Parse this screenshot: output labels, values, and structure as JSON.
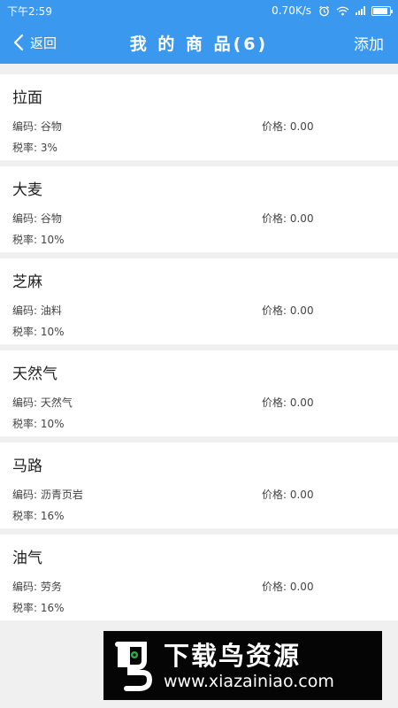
{
  "status_bar": {
    "time": "下午2:59",
    "network_speed": "0.70K/s",
    "icons": [
      "alarm-icon",
      "wifi-icon",
      "signal-icon",
      "battery-icon"
    ],
    "battery_level": 0.9
  },
  "nav": {
    "back_label": "返回",
    "title": "我 的 商 品(6)",
    "add_label": "添加"
  },
  "products": [
    {
      "name": "拉面",
      "code": "编码: 谷物",
      "price": "价格: 0.00",
      "tax": "税率: 3%"
    },
    {
      "name": "大麦",
      "code": "编码: 谷物",
      "price": "价格: 0.00",
      "tax": "税率: 10%"
    },
    {
      "name": "芝麻",
      "code": "编码: 油料",
      "price": "价格: 0.00",
      "tax": "税率: 10%"
    },
    {
      "name": "天然气",
      "code": "编码: 天然气",
      "price": "价格: 0.00",
      "tax": "税率: 10%"
    },
    {
      "name": "马路",
      "code": "编码: 沥青页岩",
      "price": "价格: 0.00",
      "tax": "税率: 16%"
    },
    {
      "name": "油气",
      "code": "编码: 劳务",
      "price": "价格: 0.00",
      "tax": "税率: 16%"
    }
  ],
  "watermark": {
    "title": "下载鸟资源",
    "url": "www.xiazainiao.com"
  },
  "colors": {
    "header": "#3a98ee",
    "background": "#f0f0f0",
    "card": "#ffffff"
  }
}
